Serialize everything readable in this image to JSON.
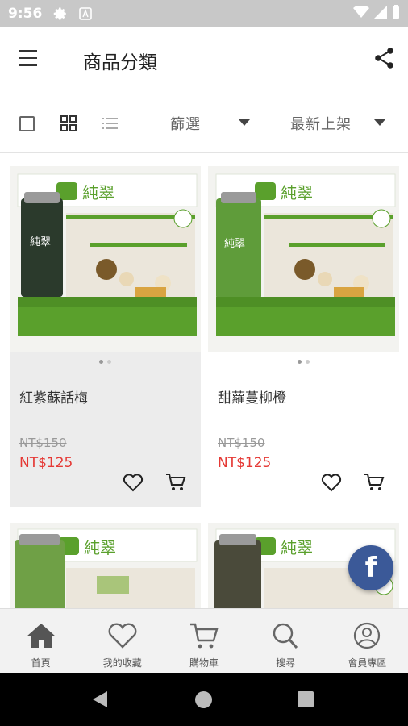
{
  "status": {
    "time": "9:56",
    "icons": [
      "gear-icon",
      "a-icon",
      "wifi-icon",
      "signal-icon",
      "battery-icon"
    ]
  },
  "header": {
    "title": "商品分類",
    "menu_icon": "hamburger-icon",
    "share_icon": "share-icon"
  },
  "toolbar": {
    "view_icons": [
      "checkbox-icon",
      "grid-view-icon",
      "list-view-icon"
    ],
    "filter_label": "篩選",
    "sort_label": "最新上架"
  },
  "products": [
    {
      "name": "紅紫蘇話梅",
      "original_price": "NT$150",
      "sale_price": "NT$125",
      "image_dots": 2,
      "active_dot": 0,
      "bottle_color": "#2b3a2c",
      "brand": "純翠"
    },
    {
      "name": "甜蘿蔓柳橙",
      "original_price": "NT$150",
      "sale_price": "NT$125",
      "image_dots": 2,
      "active_dot": 0,
      "bottle_color": "#5f9c3a",
      "brand": "純翠"
    },
    {
      "name": "",
      "original_price": "",
      "sale_price": "",
      "bottle_color": "#6fa046",
      "brand": "純翠"
    },
    {
      "name": "",
      "original_price": "",
      "sale_price": "",
      "bottle_color": "#4a4a3a",
      "brand": "純翠"
    }
  ],
  "fab": {
    "label": "f",
    "icon": "facebook-icon"
  },
  "tabs": [
    {
      "label": "首頁",
      "icon": "home-icon"
    },
    {
      "label": "我的收藏",
      "icon": "heart-icon"
    },
    {
      "label": "購物車",
      "icon": "cart-icon"
    },
    {
      "label": "搜尋",
      "icon": "search-icon"
    },
    {
      "label": "會員專區",
      "icon": "user-icon"
    }
  ],
  "colors": {
    "accent_red": "#e53935",
    "status_bar": "#c8c8c8",
    "facebook": "#3b5998",
    "brand_green": "#5aa02c"
  }
}
